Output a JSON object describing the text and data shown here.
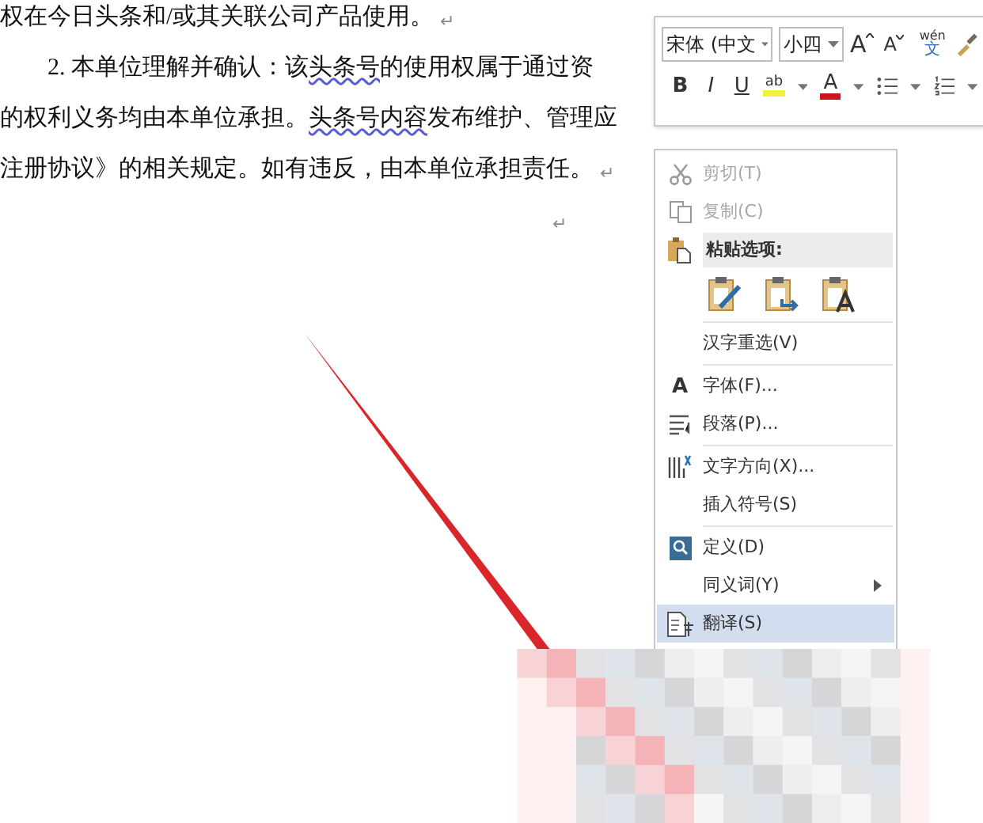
{
  "document": {
    "lines": [
      {
        "kind": "text",
        "segments": [
          {
            "text": "权在今日头条和/或其关联公司产品使用。",
            "flagged": false
          }
        ],
        "mark": "↵"
      },
      {
        "kind": "numbered",
        "segments": [
          {
            "text": "2.  本单位理解并确认：该",
            "flagged": false
          },
          {
            "text": "头条号",
            "flagged": true
          },
          {
            "text": "的使用权属于通过资",
            "flagged": false
          }
        ]
      },
      {
        "kind": "text",
        "segments": [
          {
            "text": "的权利义务均由本单位承担。",
            "flagged": false
          },
          {
            "text": "头条号内容",
            "flagged": true
          },
          {
            "text": "发布维护、管理应",
            "flagged": false
          }
        ]
      },
      {
        "kind": "text",
        "segments": [
          {
            "text": "注册协议》的相关规定。如有违反，由本单位承担责任。",
            "flagged": false
          }
        ],
        "mark": "↵"
      },
      {
        "kind": "empty",
        "mark": "↵"
      }
    ]
  },
  "mini_toolbar": {
    "font": "宋体 (中文",
    "size": "小四",
    "grow": "A",
    "shrink": "A",
    "phonetic_top": "wén",
    "phonetic_bottom": "文",
    "bold": "B",
    "italic": "I",
    "underline": "U",
    "highlight": "ab",
    "font_color": "A"
  },
  "context_menu": {
    "items": [
      {
        "kind": "item",
        "label": "剪切(T)",
        "disabled": true,
        "selected": false,
        "submenu": false
      },
      {
        "kind": "item",
        "label": "复制(C)",
        "disabled": true,
        "selected": false,
        "submenu": false
      },
      {
        "kind": "header",
        "label": "粘贴选项:"
      },
      {
        "kind": "paste_options"
      },
      {
        "kind": "separator"
      },
      {
        "kind": "item",
        "label": "汉字重选(V)",
        "disabled": false,
        "selected": false,
        "submenu": false
      },
      {
        "kind": "separator"
      },
      {
        "kind": "item",
        "label": "字体(F)...",
        "glyph": "A",
        "disabled": false,
        "selected": false,
        "submenu": false
      },
      {
        "kind": "item",
        "label": "段落(P)...",
        "disabled": false,
        "selected": false,
        "submenu": false
      },
      {
        "kind": "separator"
      },
      {
        "kind": "item",
        "label": "文字方向(X)...",
        "disabled": false,
        "selected": false,
        "submenu": false
      },
      {
        "kind": "item",
        "label": "插入符号(S)",
        "disabled": false,
        "selected": false,
        "submenu": false
      },
      {
        "kind": "separator"
      },
      {
        "kind": "item",
        "label": "定义(D)",
        "disabled": false,
        "selected": false,
        "submenu": false
      },
      {
        "kind": "item",
        "label": "同义词(Y)",
        "disabled": false,
        "selected": false,
        "submenu": true
      },
      {
        "kind": "item",
        "label": "翻译(S)",
        "disabled": false,
        "selected": true,
        "submenu": false
      }
    ]
  }
}
